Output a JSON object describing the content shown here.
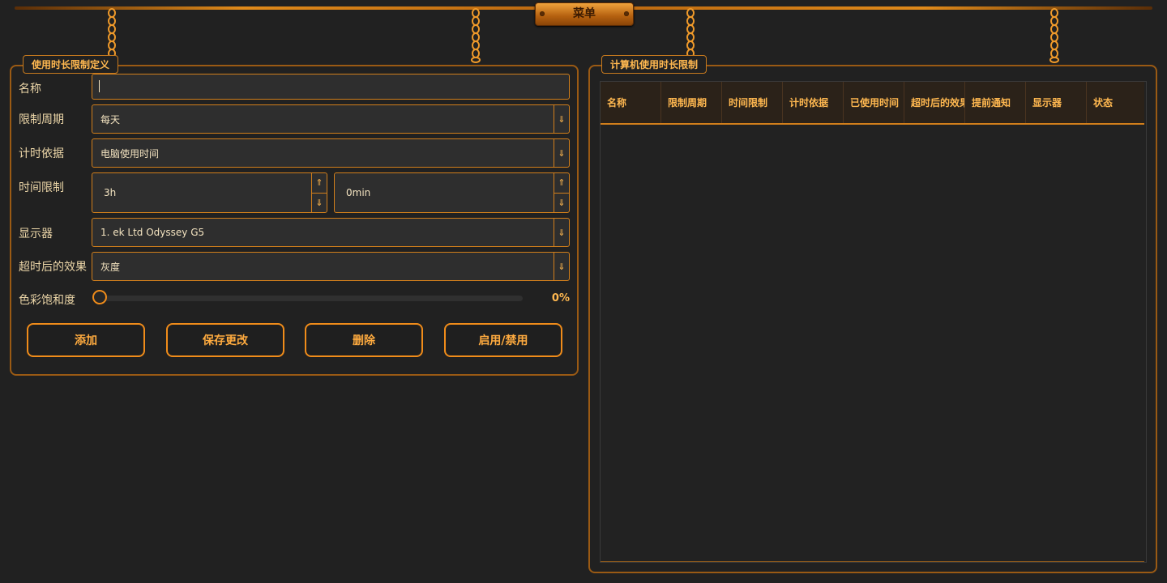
{
  "menu": {
    "label": "菜单"
  },
  "left_panel": {
    "title": "使用时长限制定义",
    "fields": {
      "name": {
        "label": "名称",
        "value": ""
      },
      "period": {
        "label": "限制周期",
        "value": "每天"
      },
      "basis": {
        "label": "计时依据",
        "value": "电脑使用时间"
      },
      "time_limit": {
        "label": "时间限制",
        "hours": "3h",
        "minutes": "0min"
      },
      "monitor": {
        "label": "显示器",
        "value": "1. ek Ltd Odyssey G5"
      },
      "effect": {
        "label": "超时后的效果",
        "value": "灰度"
      },
      "saturation": {
        "label": "色彩饱和度",
        "value": "0%",
        "fraction": 0
      }
    },
    "buttons": {
      "add": "添加",
      "save": "保存更改",
      "delete": "删除",
      "toggle": "启用/禁用"
    }
  },
  "right_panel": {
    "title": "计算机使用时长限制",
    "columns": [
      "名称",
      "限制周期",
      "时间限制",
      "计时依据",
      "已使用时间",
      "超时后的效果",
      "提前通知",
      "显示器",
      "状态"
    ],
    "rows": []
  },
  "colors": {
    "accent": "#f08c1a",
    "background": "#212121",
    "text": "#ecd6a8"
  },
  "icons": {
    "dropdown": "down-arrow-icon",
    "spin_up": "up-arrow-icon",
    "spin_down": "down-arrow-icon",
    "chain": "chain-icon"
  }
}
